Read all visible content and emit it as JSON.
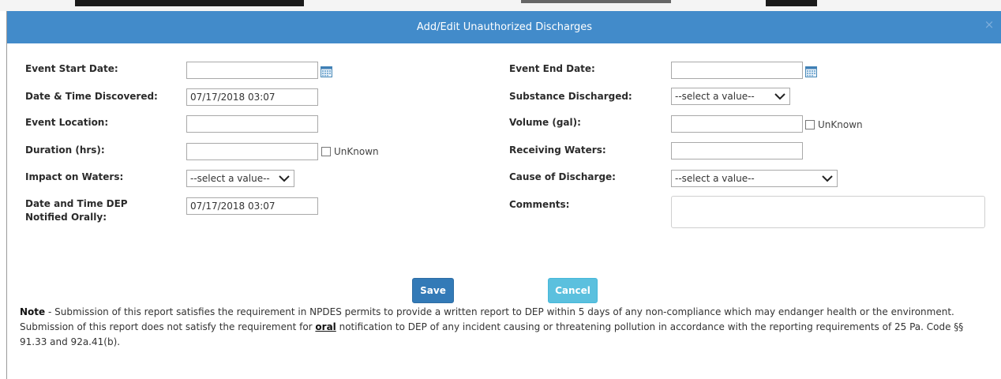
{
  "dialog": {
    "title": "Add/Edit Unauthorized Discharges",
    "close_symbol": "×",
    "close_icon": "close-icon",
    "calendar_icon": "calendar-icon",
    "colors": {
      "titlebar": "#428bca",
      "save_button": "#337ab7",
      "cancel_button": "#5bc0de"
    }
  },
  "left": {
    "event_start_date": {
      "label": "Event Start Date:",
      "value": ""
    },
    "date_time_discovered": {
      "label": "Date & Time Discovered:",
      "value": "07/17/2018 03:07"
    },
    "event_location": {
      "label": "Event Location:",
      "value": ""
    },
    "duration": {
      "label": "Duration (hrs):",
      "value": "",
      "unknown_label": "UnKnown"
    },
    "impact_on_waters": {
      "label": "Impact on Waters:",
      "selected": "--select a value--"
    },
    "dep_notified_orally": {
      "label": "Date and Time DEP Notified Orally:",
      "value": "07/17/2018 03:07"
    }
  },
  "right": {
    "event_end_date": {
      "label": "Event End Date:",
      "value": ""
    },
    "substance_discharged": {
      "label": "Substance Discharged:",
      "selected": "--select a value--"
    },
    "volume": {
      "label": "Volume (gal):",
      "value": "",
      "unknown_label": "UnKnown"
    },
    "receiving_waters": {
      "label": "Receiving Waters:",
      "value": ""
    },
    "cause_of_discharge": {
      "label": "Cause of Discharge:",
      "selected": "--select a value--"
    },
    "comments": {
      "label": "Comments:",
      "value": ""
    }
  },
  "buttons": {
    "save": "Save",
    "cancel": "Cancel"
  },
  "note": {
    "label": "Note",
    "text_1": " - Submission of this report satisfies the requirement in NPDES permits to provide a written report to DEP within 5 days of any non-compliance which may endanger health or the environment. Submission of this report does not satisfy the requirement for ",
    "emphasis": "oral",
    "text_2": " notification to DEP of any incident causing or threatening pollution in accordance with the reporting requirements of 25 Pa. Code §§ 91.33 and 92a.41(b)."
  }
}
